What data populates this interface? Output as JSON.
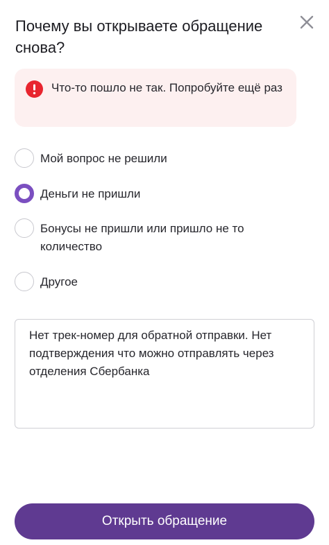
{
  "header": {
    "title": "Почему вы открываете обращение снова?",
    "close_icon": "close-icon"
  },
  "error_banner": {
    "icon": "error-icon",
    "text": "Что-то пошло не так. Попробуйте ещё раз",
    "icon_color": "#e8252f",
    "background": "#fdf0f0"
  },
  "reasons": {
    "options": [
      {
        "label": "Мой вопрос не решили",
        "selected": false
      },
      {
        "label": "Деньги не пришли",
        "selected": true
      },
      {
        "label": "Бонусы не пришли или пришло не то количество",
        "selected": false
      },
      {
        "label": "Другое",
        "selected": false
      }
    ]
  },
  "comment": {
    "value": "Нет трек-номер для обратной отправки. Нет подтверждения что можно отправлять через отделения Сбербанка"
  },
  "submit": {
    "label": "Открыть обращение",
    "color": "#5f3a91"
  },
  "colors": {
    "accent": "#7b4fc0"
  }
}
